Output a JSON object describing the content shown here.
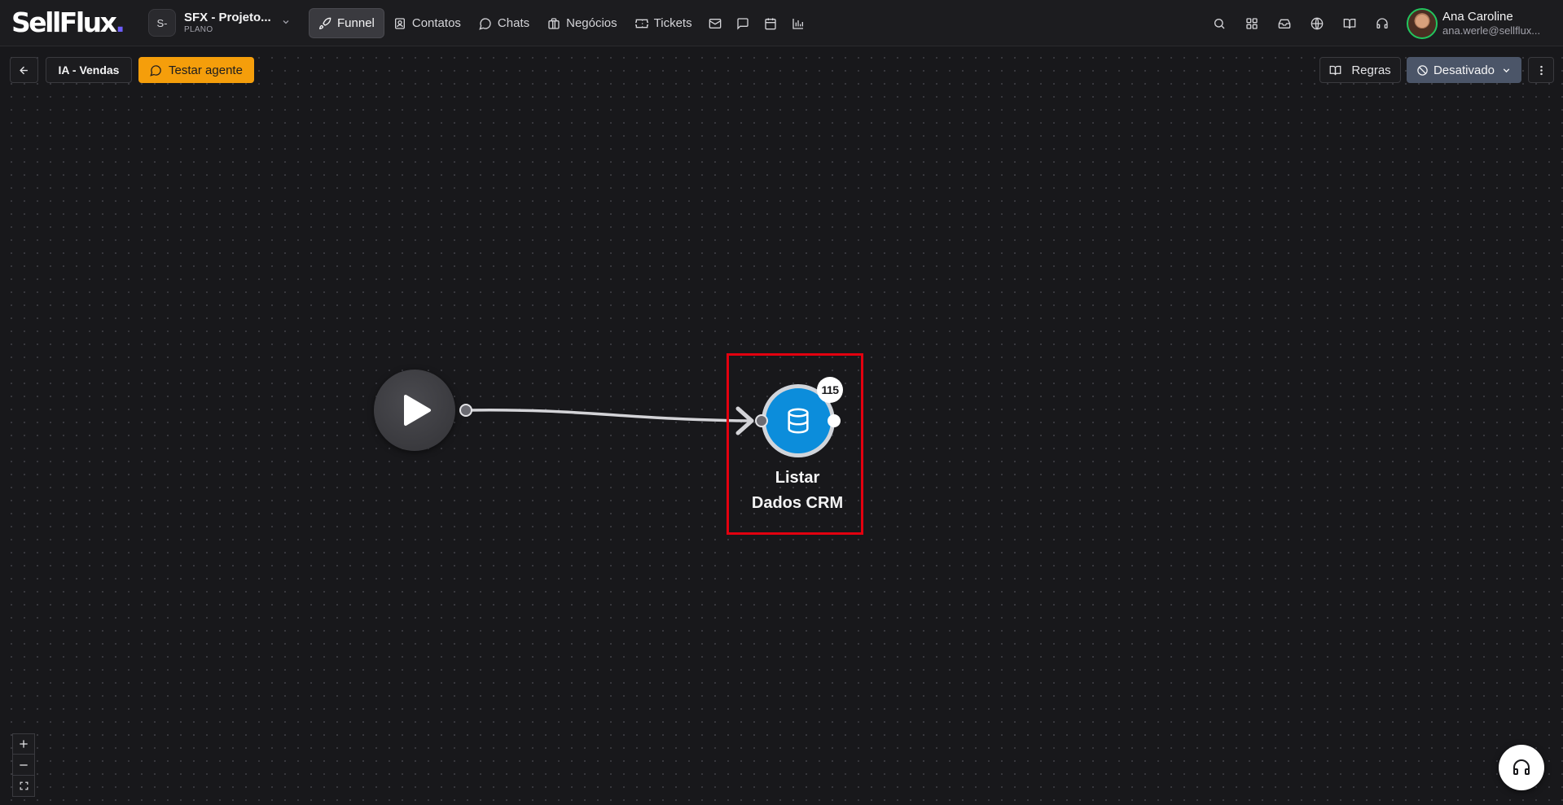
{
  "brand": {
    "logo_text": "SellFlux",
    "logo_dot": "."
  },
  "workspace": {
    "avatar": "S-",
    "name": "SFX - Projeto...",
    "plan": "PLANO"
  },
  "nav": {
    "items": [
      {
        "label": "Funnel",
        "icon": "rocket-icon",
        "active": true
      },
      {
        "label": "Contatos",
        "icon": "contact-icon"
      },
      {
        "label": "Chats",
        "icon": "chat-icon"
      },
      {
        "label": "Negócios",
        "icon": "briefcase-icon"
      },
      {
        "label": "Tickets",
        "icon": "ticket-icon"
      }
    ],
    "icon_only": [
      "mail-icon",
      "message-square-icon",
      "calendar-icon",
      "bar-chart-icon"
    ]
  },
  "top_right_icons": [
    "search-icon",
    "grid-icon",
    "inbox-icon",
    "globe-icon",
    "book-icon",
    "headset-icon"
  ],
  "user": {
    "name": "Ana Caroline",
    "email": "ana.werle@sellflux..."
  },
  "toolbar": {
    "flow_name": "IA - Vendas",
    "test_label": "Testar agente",
    "rules_label": "Regras",
    "status_label": "Desativado"
  },
  "flow": {
    "start_node": {
      "icon": "play-icon"
    },
    "crm_node": {
      "icon": "database-icon",
      "badge": "115",
      "label_line1": "Listar",
      "label_line2": "Dados CRM"
    }
  },
  "colors": {
    "accent_orange": "#f59e0b",
    "node_blue": "#0c8ddb",
    "status_gray": "#4b5568",
    "highlight_red": "#e3000f",
    "online_green": "#22c55e"
  }
}
